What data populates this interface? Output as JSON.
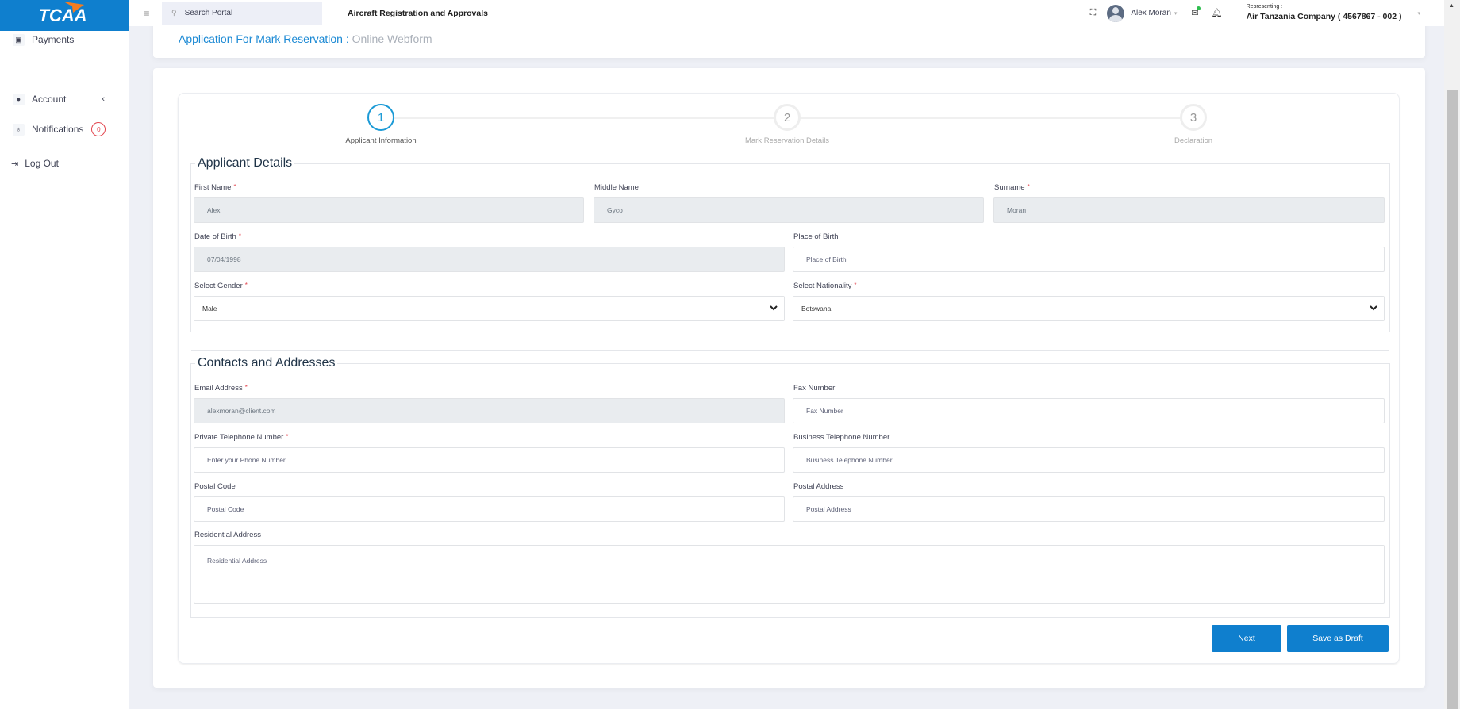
{
  "brand": {
    "logo_text": "TCAA",
    "color": "#0f7fce",
    "accent": "#f47c20"
  },
  "sidebar": {
    "items": [
      {
        "label": "Payments",
        "icon": "money-icon"
      },
      {
        "label": "Account",
        "icon": "user-icon"
      },
      {
        "label": "Notifications",
        "icon": "bell-icon",
        "badge": "0"
      },
      {
        "label": "Log Out",
        "icon": "logout-icon"
      }
    ]
  },
  "header": {
    "search_placeholder": "Search Portal",
    "app_title": "Aircraft Registration and Approvals",
    "user_name": "Alex Moran",
    "representing_label": "Representing :",
    "representing_value": "Air Tanzania Company ( 4567867 - 002 )"
  },
  "page": {
    "title": "Application For Mark Reservation :",
    "subtitle": "Online Webform"
  },
  "steps": [
    {
      "number": "1",
      "label": "Applicant Information",
      "active": true
    },
    {
      "number": "2",
      "label": "Mark Reservation Details",
      "active": false
    },
    {
      "number": "3",
      "label": "Declaration",
      "active": false
    }
  ],
  "applicant": {
    "legend": "Applicant Details",
    "first_name": {
      "label": "First Name",
      "value": "Alex"
    },
    "middle_name": {
      "label": "Middle Name",
      "value": "Gyco"
    },
    "surname": {
      "label": "Surname",
      "value": "Moran"
    },
    "dob": {
      "label": "Date of Birth",
      "value": "07/04/1998"
    },
    "pob": {
      "label": "Place of Birth",
      "placeholder": "Place of Birth"
    },
    "gender": {
      "label": "Select Gender",
      "value": "Male"
    },
    "nationality": {
      "label": "Select Nationality",
      "value": "Botswana"
    }
  },
  "contacts": {
    "legend": "Contacts and Addresses",
    "email": {
      "label": "Email Address",
      "value": "alexmoran@client.com"
    },
    "fax": {
      "label": "Fax Number",
      "placeholder": "Fax Number"
    },
    "private_phone": {
      "label": "Private Telephone Number",
      "placeholder": "Enter your Phone Number"
    },
    "business_phone": {
      "label": "Business Telephone Number",
      "placeholder": "Business Telephone Number"
    },
    "postal_code": {
      "label": "Postal Code",
      "placeholder": "Postal Code"
    },
    "postal_address": {
      "label": "Postal Address",
      "placeholder": "Postal Address"
    },
    "residential": {
      "label": "Residential Address",
      "placeholder": "Residential Address"
    }
  },
  "actions": {
    "next": "Next",
    "save_draft": "Save as Draft"
  },
  "required_mark": "*"
}
